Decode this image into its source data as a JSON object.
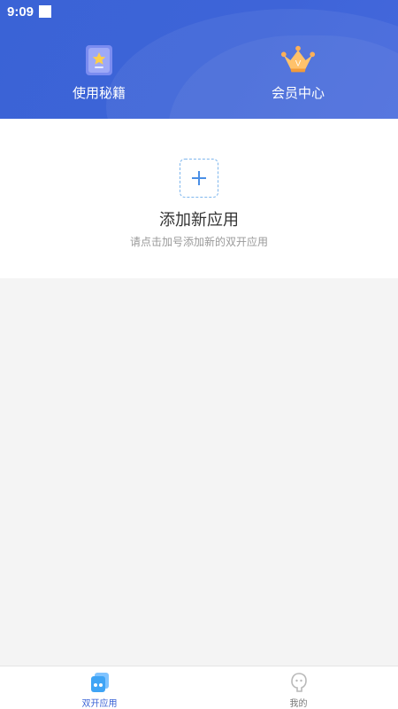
{
  "status_bar": {
    "time": "9:09"
  },
  "header": {
    "tips_label": "使用秘籍",
    "vip_label": "会员中心",
    "colors": {
      "background": "#3a63d6",
      "text": "#ffffff"
    }
  },
  "add_app": {
    "title": "添加新应用",
    "subtitle": "请点击加号添加新的双开应用",
    "button_icon": "plus-icon"
  },
  "tabbar": {
    "tabs": [
      {
        "label": "双开应用",
        "icon": "dual-apps-icon",
        "active": true
      },
      {
        "label": "我的",
        "icon": "profile-icon",
        "active": false
      }
    ],
    "active_color": "#3a63d6"
  }
}
